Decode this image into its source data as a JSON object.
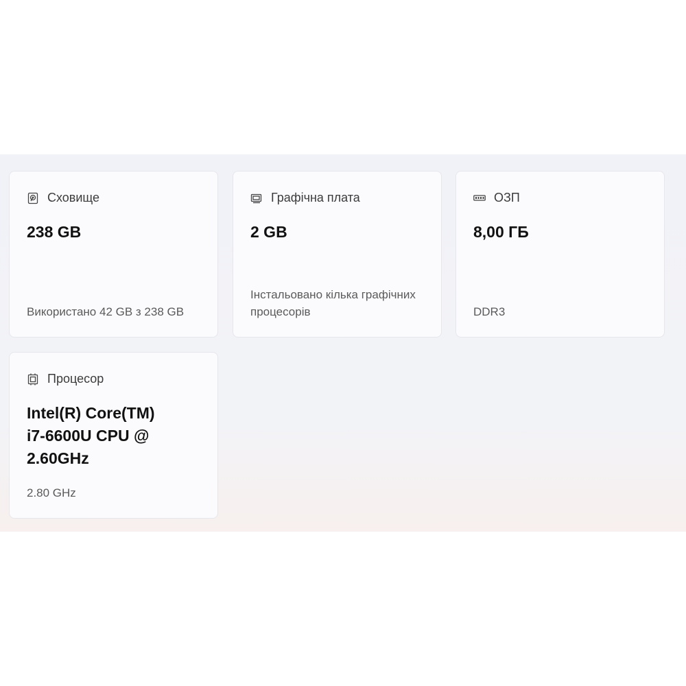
{
  "cards": [
    {
      "icon": "storage-icon",
      "title": "Сховище",
      "value": "238 GB",
      "sub": "Використано 42 GB з 238 GB"
    },
    {
      "icon": "graphics-card-icon",
      "title": "Графічна плата",
      "value": "2 GB",
      "sub": "Інстальовано кілька графічних процесорів"
    },
    {
      "icon": "ram-icon",
      "title": "ОЗП",
      "value": "8,00 ГБ",
      "sub": "DDR3"
    },
    {
      "icon": "processor-icon",
      "title": "Процесор",
      "value": "Intel(R) Core(TM) i7-6600U CPU @ 2.60GHz",
      "sub": "2.80 GHz"
    }
  ]
}
